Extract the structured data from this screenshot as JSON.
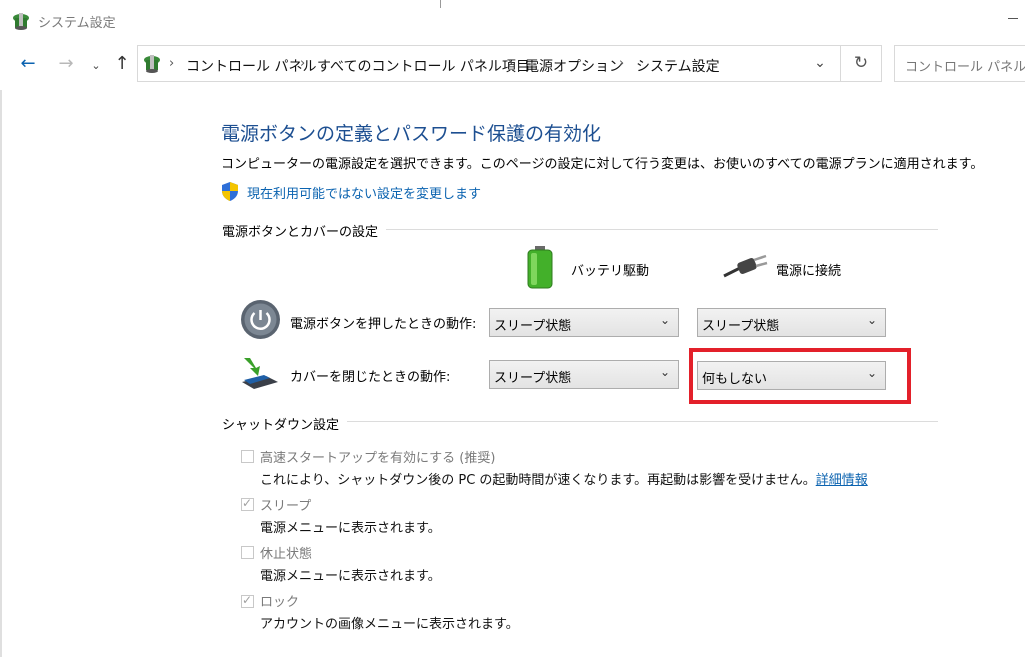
{
  "window": {
    "title": "システム設定"
  },
  "breadcrumb": [
    "コントロール パネル",
    "すべてのコントロール パネル項目",
    "電源オプション",
    "システム設定"
  ],
  "search": {
    "placeholder": "コントロール パネルの検"
  },
  "page": {
    "heading": "電源ボタンの定義とパスワード保護の有効化",
    "description": "コンピューターの電源設定を選択できます。このページの設定に対して行う変更は、お使いのすべての電源プランに適用されます。",
    "admin_link": "現在利用可能ではない設定を変更します"
  },
  "power_settings": {
    "group_title": "電源ボタンとカバーの設定",
    "col_battery": "バッテリ駆動",
    "col_plugged": "電源に接続",
    "rows": [
      {
        "label": "電源ボタンを押したときの動作:",
        "battery": "スリープ状態",
        "plugged": "スリープ状態"
      },
      {
        "label": "カバーを閉じたときの動作:",
        "battery": "スリープ状態",
        "plugged": "何もしない"
      }
    ]
  },
  "shutdown": {
    "group_title": "シャットダウン設定",
    "options": [
      {
        "label": "高速スタートアップを有効にする (推奨)",
        "desc": "これにより、シャットダウン後の PC の起動時間が速くなります。再起動は影響を受けません。",
        "link": "詳細情報",
        "checked": false
      },
      {
        "label": "スリープ",
        "desc": "電源メニューに表示されます。",
        "checked": true
      },
      {
        "label": "休止状態",
        "desc": "電源メニューに表示されます。",
        "checked": false
      },
      {
        "label": "ロック",
        "desc": "アカウントの画像メニューに表示されます。",
        "checked": true
      }
    ]
  },
  "colors": {
    "accent_link": "#0b63b0",
    "heading": "#1d4f91",
    "highlight": "#e3202a"
  },
  "icons": [
    "power-options-icon",
    "back-arrow-icon",
    "forward-arrow-icon",
    "chevron-down-icon",
    "up-arrow-icon",
    "refresh-icon",
    "shield-icon",
    "battery-icon",
    "plug-icon",
    "power-button-icon",
    "laptop-lid-icon"
  ]
}
